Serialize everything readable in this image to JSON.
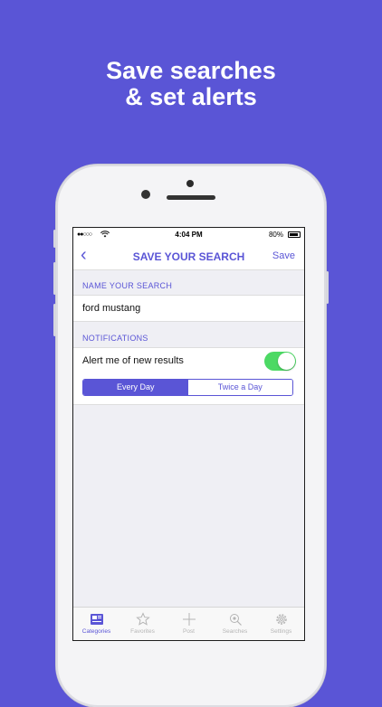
{
  "headline": [
    "Save searches",
    "& set alerts"
  ],
  "status_bar": {
    "time": "4:04 PM",
    "battery": "80%"
  },
  "nav": {
    "title": "SAVE YOUR SEARCH",
    "save_label": "Save"
  },
  "name_section": {
    "label": "NAME YOUR SEARCH",
    "value": "ford mustang"
  },
  "notifications": {
    "label": "NOTIFICATIONS",
    "alert_text": "Alert me of new results",
    "alert_enabled": true,
    "frequency_options": [
      "Every Day",
      "Twice a Day"
    ],
    "selected_frequency": "Every Day"
  },
  "tabs": [
    {
      "label": "Categories",
      "icon": "categories-icon",
      "active": true
    },
    {
      "label": "Favorites",
      "icon": "star-icon",
      "active": false
    },
    {
      "label": "Post",
      "icon": "plus-icon",
      "active": false
    },
    {
      "label": "Searches",
      "icon": "search-icon",
      "active": false
    },
    {
      "label": "Settings",
      "icon": "gear-icon",
      "active": false
    }
  ],
  "colors": {
    "accent": "#5a55d6",
    "toggle_on": "#4cd964",
    "background": "#5a55d6"
  }
}
